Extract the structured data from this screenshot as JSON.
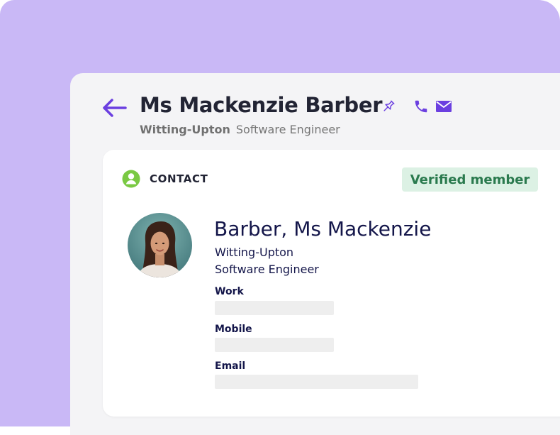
{
  "header": {
    "title": "Ms Mackenzie Barber",
    "company": "Witting-Upton",
    "job_title": "Software Engineer"
  },
  "icons": {
    "back": "arrow-left-icon",
    "pin": "pin-icon",
    "phone": "phone-icon",
    "mail": "mail-icon",
    "contact": "user-circle-icon"
  },
  "card": {
    "section_label": "CONTACT",
    "badge": "Verified member",
    "name": "Barber, Ms Mackenzie",
    "company": "Witting-Upton",
    "job_title": "Software Engineer",
    "fields": {
      "work_label": "Work",
      "work_value": "",
      "mobile_label": "Mobile",
      "mobile_value": "",
      "email_label": "Email",
      "email_value": ""
    }
  },
  "colors": {
    "accent": "#6b3fe0",
    "background": "#c9b8f6",
    "badge_bg": "#dcf1e4",
    "badge_text": "#2a7a4e",
    "contact_icon": "#7ac943",
    "navy": "#14164a"
  }
}
